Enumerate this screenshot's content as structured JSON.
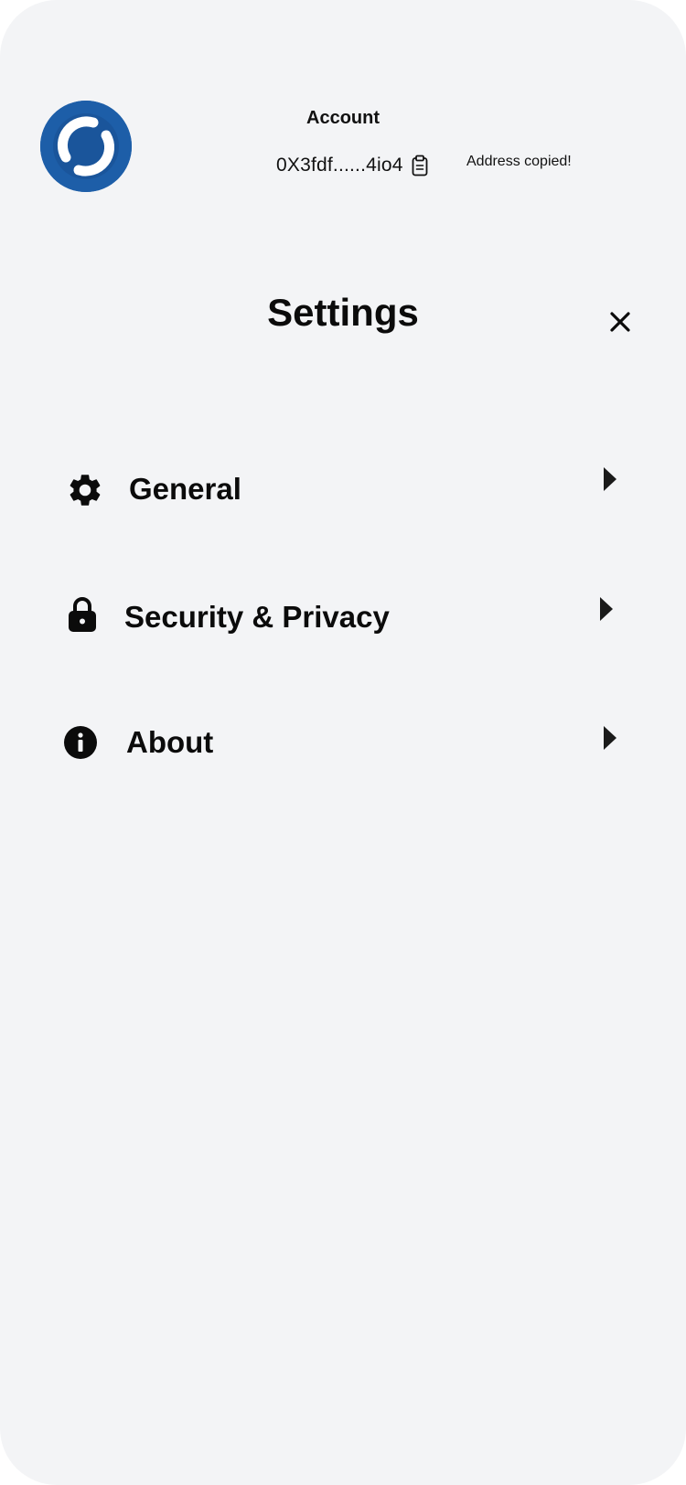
{
  "header": {
    "account_label": "Account",
    "address": "0X3fdf......4io4",
    "copied_message": "Address copied!"
  },
  "logo": {
    "icon": "circular-logo-icon",
    "color": "#1d5ea8"
  },
  "settings": {
    "title": "Settings",
    "close_icon": "close-icon"
  },
  "menu": {
    "items": [
      {
        "label": "General",
        "icon": "gear-icon"
      },
      {
        "label": "Security & Privacy",
        "icon": "lock-icon"
      },
      {
        "label": "About",
        "icon": "info-icon"
      }
    ],
    "arrow_icon": "caret-right-icon"
  },
  "colors": {
    "background": "#f3f4f6",
    "text": "#0b0b0b",
    "brand": "#1d5ea8"
  }
}
